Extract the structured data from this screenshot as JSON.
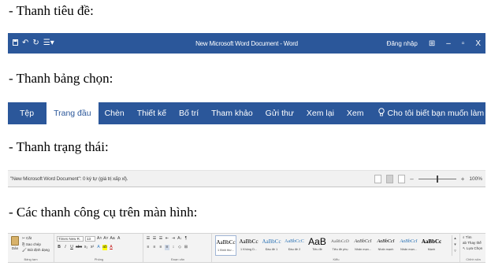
{
  "captions": {
    "title_bar": "- Thanh tiêu đề:",
    "tabs_bar": "- Thanh bảng chọn:",
    "status_bar": "- Thanh trạng thái:",
    "toolbars": "- Các thanh công cụ trên màn hình:"
  },
  "colors": {
    "accent": "#2b579a",
    "active_tab_bg": "#ffffff",
    "ribbon_bg": "#f3f3f3"
  },
  "title_bar": {
    "quick_access": {
      "save_icon": "save-icon",
      "undo_icon": "undo-icon",
      "redo_icon": "redo-icon",
      "customize_icon": "customize-icon"
    },
    "document_title": "New Microsoft Word Document - Word",
    "sign_in": "Đăng nhập",
    "ribbon_display_icon": "ribbon-display-icon",
    "minimize": "–",
    "restore": "▫",
    "close": "X"
  },
  "tabs_bar": {
    "tabs": [
      {
        "label": "Tệp",
        "active": false
      },
      {
        "label": "Trang đầu",
        "active": true
      },
      {
        "label": "Chèn",
        "active": false
      },
      {
        "label": "Thiết kế",
        "active": false
      },
      {
        "label": "Bố trí",
        "active": false
      },
      {
        "label": "Tham khảo",
        "active": false
      },
      {
        "label": "Gửi thư",
        "active": false
      },
      {
        "label": "Xem lại",
        "active": false
      },
      {
        "label": "Xem",
        "active": false
      }
    ],
    "tell_me": "Cho tôi biết bạn muốn làm gì"
  },
  "status_bar": {
    "text": "\"New Microsoft Word Document\": 0 ký tự (giá trị xấp xỉ).",
    "zoom_minus": "–",
    "zoom_plus": "+",
    "zoom": "100%"
  },
  "ribbon": {
    "clipboard": {
      "paste": "Dán",
      "cut": "Cắt",
      "copy": "Sao chép",
      "format_painter": "Bút định dạng",
      "label": "Bảng tạm"
    },
    "font": {
      "name": "Times New R.",
      "size": "13",
      "grow": "A˄",
      "shrink": "A˅",
      "change_case": "Aa",
      "clear": "A",
      "bold": "B",
      "italic": "I",
      "underline": "U",
      "strike": "abc",
      "subscript": "x₂",
      "superscript": "x²",
      "effects": "A",
      "highlight": "ab",
      "color": "A",
      "label": "Phông"
    },
    "paragraph": {
      "sort": "A↓",
      "pilcrow": "¶",
      "label": "Đoạn văn"
    },
    "styles": {
      "items": [
        {
          "sample": "AaBbCc",
          "name": "1 Bình thư..."
        },
        {
          "sample": "AaBbCc",
          "name": "1 Không D..."
        },
        {
          "sample": "AaBbCc",
          "name": "Đầu đề 1"
        },
        {
          "sample": "AaBbCcC",
          "name": "Đầu đề 2"
        },
        {
          "sample": "AaB",
          "name": "Tiêu đề"
        },
        {
          "sample": "AaBbCcD",
          "name": "Tiêu đề phụ"
        },
        {
          "sample": "AaBbCcI",
          "name": "Nhấn mạn..."
        },
        {
          "sample": "AaBbCcI",
          "name": "Nhấn mạnh"
        },
        {
          "sample": "AaBbCcI",
          "name": "Nhấn mạn..."
        },
        {
          "sample": "AaBbCc",
          "name": "Mạnh"
        }
      ],
      "label": "Kiểu"
    },
    "editing": {
      "find": "Tìm",
      "replace": "Thay thế",
      "select": "Lựa Chọn",
      "label": "Chỉnh sửa"
    }
  }
}
